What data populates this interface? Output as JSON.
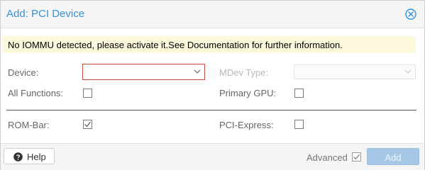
{
  "dialog": {
    "title": "Add: PCI Device",
    "close_icon": "close-circle-icon"
  },
  "warning": {
    "text": "No IOMMU detected, please activate it.See Documentation for further information."
  },
  "form": {
    "device_label": "Device:",
    "device_value": "",
    "mdev_label": "MDev Type:",
    "mdev_value": "",
    "all_functions_label": "All Functions:",
    "all_functions_checked": false,
    "primary_gpu_label": "Primary GPU:",
    "primary_gpu_checked": false,
    "rombar_label": "ROM-Bar:",
    "rombar_checked": true,
    "pcie_label": "PCI-Express:",
    "pcie_checked": false
  },
  "footer": {
    "help_label": "Help",
    "advanced_label": "Advanced",
    "advanced_checked": true,
    "add_label": "Add"
  },
  "colors": {
    "accent": "#3892d4",
    "invalid_border": "#c34a3d",
    "warning_bg": "#fcf8dc",
    "add_button_disabled": "#a5c8e6"
  }
}
